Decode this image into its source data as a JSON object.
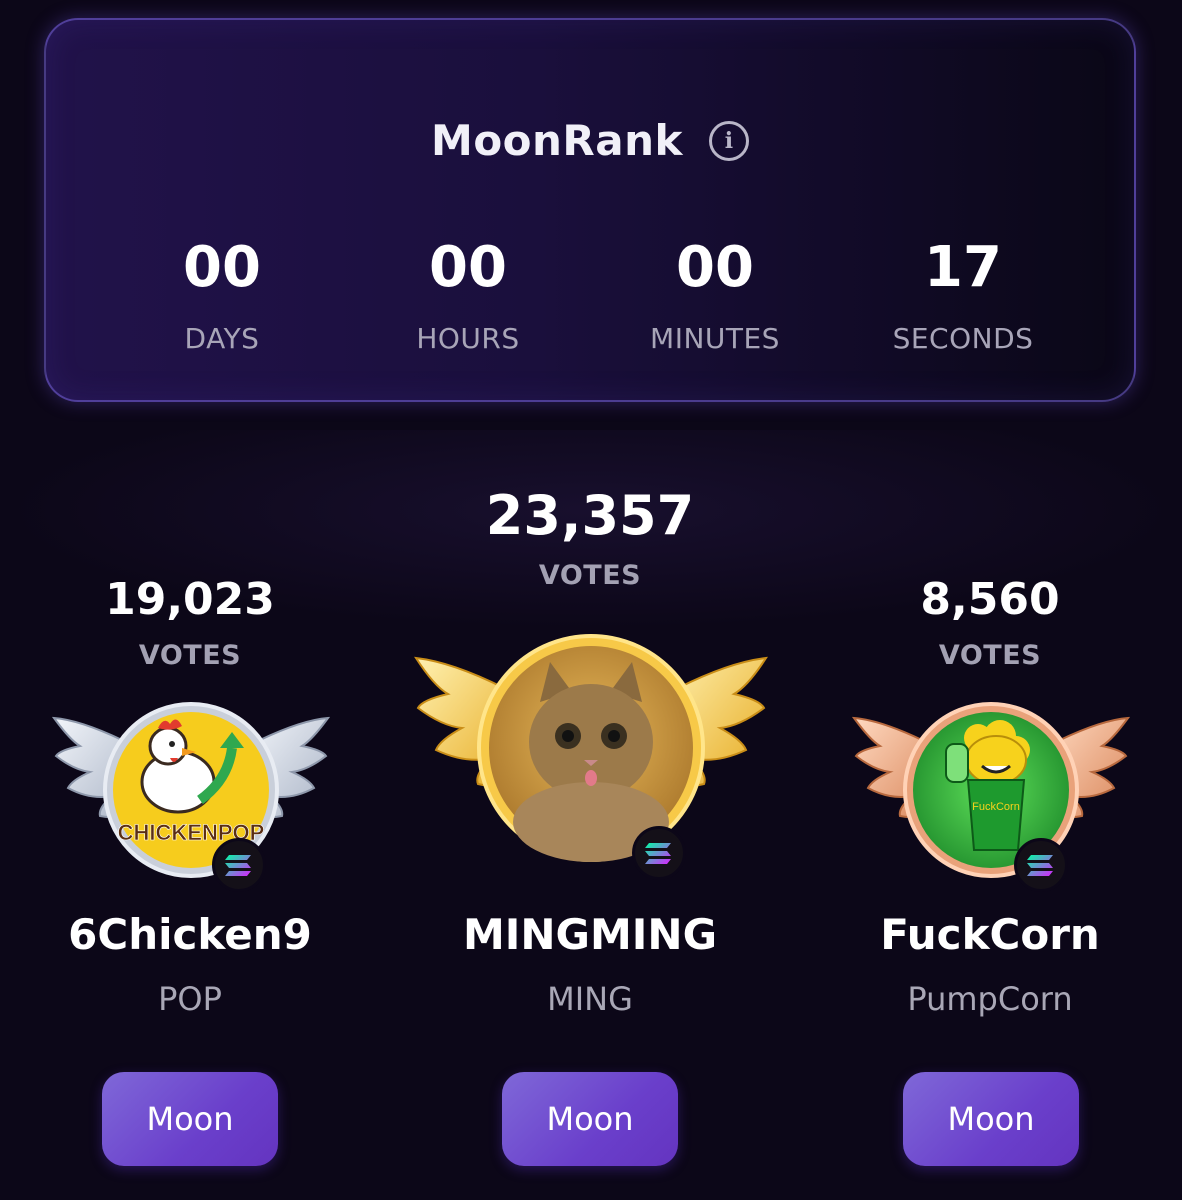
{
  "countdown": {
    "title": "MoonRank",
    "info_icon": "info-icon",
    "units": [
      {
        "value": "00",
        "label": "DAYS"
      },
      {
        "value": "00",
        "label": "HOURS"
      },
      {
        "value": "00",
        "label": "MINUTES"
      },
      {
        "value": "17",
        "label": "SECONDS"
      }
    ]
  },
  "podium": {
    "second": {
      "votes": "19,023",
      "votes_label": "VOTES",
      "name": "6Chicken9",
      "ticker": "POP",
      "logo_text": "CHICKENPOP",
      "button": "Moon",
      "wing_color": "#d4dbe8"
    },
    "first": {
      "votes": "23,357",
      "votes_label": "VOTES",
      "name": "MINGMING",
      "ticker": "MING",
      "button": "Moon",
      "wing_color": "#f4c542"
    },
    "third": {
      "votes": "8,560",
      "votes_label": "VOTES",
      "name": "FuckCorn",
      "ticker": "PumpCorn",
      "logo_text": "FuckCorn",
      "button": "Moon",
      "wing_color": "#f0a97e"
    }
  },
  "chain_icon": "solana-icon",
  "colors": {
    "background": "#0c0718",
    "button": "#7056d0",
    "gold": "#f4c542",
    "silver": "#d4dbe8",
    "bronze": "#f0a97e"
  }
}
